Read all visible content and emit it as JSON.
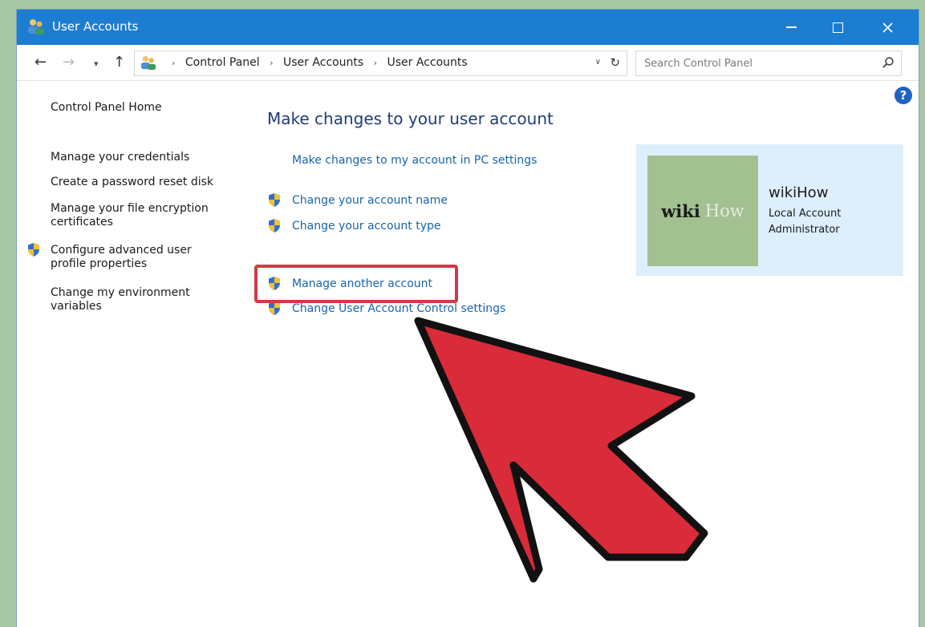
{
  "window": {
    "title": "User Accounts"
  },
  "address_bar": {
    "crumbs": [
      "Control Panel",
      "User Accounts",
      "User Accounts"
    ]
  },
  "search": {
    "placeholder": "Search Control Panel"
  },
  "help_label": "?",
  "left_nav": {
    "home": "Control Panel Home",
    "items": [
      "Manage your credentials",
      "Create a password reset disk",
      "Manage your file encryption certificates",
      "Configure advanced user profile properties",
      "Change my environment variables"
    ]
  },
  "main": {
    "heading": "Make changes to your user account",
    "pc_settings_link": "Make changes to my account in PC settings",
    "links": [
      "Change your account name",
      "Change your account type",
      "Manage another account",
      "Change User Account Control settings"
    ]
  },
  "account": {
    "name": "wikiHow",
    "type": "Local Account",
    "role": "Administrator",
    "avatar_text_1": "wiki",
    "avatar_text_2": "How"
  },
  "icons": {
    "app": "user-accounts-icon",
    "shield": "uac-shield-icon",
    "search": "search-icon",
    "refresh": "refresh-icon"
  },
  "colors": {
    "titlebar": "#1c7ed1",
    "link": "#1864ab",
    "heading": "#1e3d7a",
    "highlight": "#d53746",
    "arrow_fill": "#d92b3a",
    "account_panel": "#ddeefc"
  }
}
